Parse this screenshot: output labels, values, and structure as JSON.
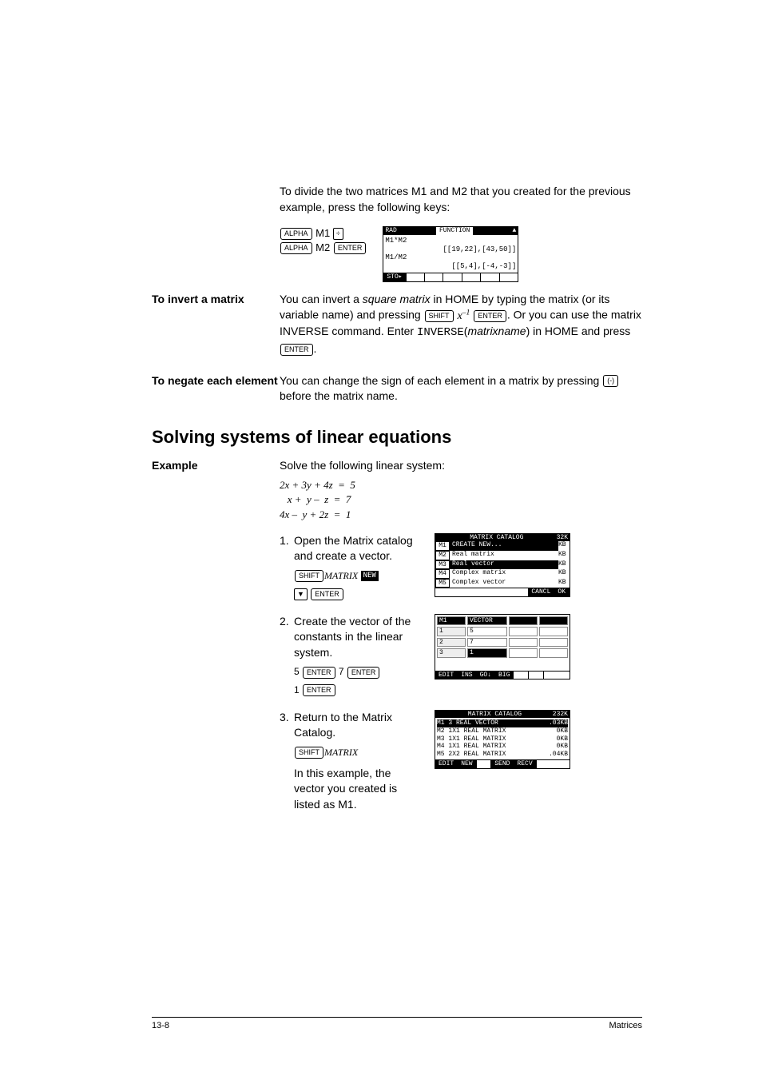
{
  "intro": {
    "text": "To divide the two matrices M1 and M2 that you created for the previous example, press the following keys:",
    "key_alpha": "ALPHA",
    "m1": "M1",
    "div_sym": "÷",
    "m2": "M2",
    "key_enter": "ENTER"
  },
  "screen1": {
    "hdr_left": "RAD",
    "hdr_center": "FUNCTION",
    "line1": "M1*M2",
    "line1r": "[[19,22],[43,50]]",
    "line2": "M1/M2",
    "line2r": "[[5,4],[-4,-3]]",
    "footer_sto": "STO▸"
  },
  "invert": {
    "label": "To invert a matrix",
    "para1a": "You can invert a ",
    "para1b": "square matrix",
    "para1c": " in HOME by typing the matrix (or its variable name) and pressing ",
    "key_shift": "SHIFT",
    "xinv": "x",
    "xinv_sup": "–1",
    "para2a": ". Or you can use the matrix INVERSE command. Enter ",
    "inverse_cmd": "INVERSE",
    "paren_open": "(",
    "matrixname": "matrixname",
    "paren_close": ")",
    "para2b": " in HOME and press",
    "key_enter": "ENTER",
    "period": "."
  },
  "negate": {
    "label": "To negate each element",
    "text1": "You can change the sign of each element in a matrix by pressing ",
    "key_neg": "(-)",
    "text2": " before the matrix name."
  },
  "solving": {
    "title": "Solving systems of linear equations",
    "example_label": "Example",
    "example_text": "Solve the following linear system:",
    "eq1": "2x + 3y + 4z  =  5",
    "eq2": "   x +  y –  z  =  7",
    "eq3": "4x –  y + 2z  =  1"
  },
  "step1": {
    "num": "1.",
    "text": "Open the Matrix catalog and create a vector.",
    "key_shift": "SHIFT",
    "key_matrix": "MATRIX",
    "new_btn": "NEW",
    "key_down": "▼",
    "key_enter": "ENTER"
  },
  "screen2": {
    "header": "MATRIX CATALOG",
    "mem": "32K",
    "m1": "M1",
    "m2": "M2",
    "m3": "M3",
    "m4": "M4",
    "m5": "M5",
    "create_new": "CREATE NEW...",
    "opt1": "Real matrix",
    "opt2": "Real vector",
    "opt3": "Complex matrix",
    "opt4": "Complex vector",
    "kb": "KB",
    "cancl": "CANCL",
    "ok": "OK"
  },
  "step2": {
    "num": "2.",
    "text": "Create the vector of the constants in the linear system.",
    "v5": "5",
    "v7": "7",
    "v1": "1",
    "key_enter": "ENTER"
  },
  "screen3": {
    "m1": "M1",
    "vector": "VECTOR",
    "r1": "1",
    "r2": "2",
    "r3": "3",
    "c1": "5",
    "c2": "7",
    "c3": "1",
    "edit": "EDIT",
    "ins": "INS",
    "go": "GO↓",
    "big": "BIG"
  },
  "step3": {
    "num": "3.",
    "text": "Return to the Matrix Catalog.",
    "key_shift": "SHIFT",
    "key_matrix": "MATRIX",
    "text2": "In this example, the vector you created is listed as M1."
  },
  "screen4": {
    "header": "MATRIX CATALOG",
    "mem": "232K",
    "r1_l": "M1 3 REAL VECTOR",
    "r1_r": ".03KB",
    "r2_l": "M2 1X1 REAL MATRIX",
    "r2_r": "0KB",
    "r3_l": "M3 1X1 REAL MATRIX",
    "r3_r": "0KB",
    "r4_l": "M4 1X1 REAL MATRIX",
    "r4_r": "0KB",
    "r5_l": "M5 2X2 REAL MATRIX",
    "r5_r": ".04KB",
    "edit": "EDIT",
    "new": "NEW",
    "send": "SEND",
    "recv": "RECV"
  },
  "footer": {
    "page": "13-8",
    "title": "Matrices"
  }
}
